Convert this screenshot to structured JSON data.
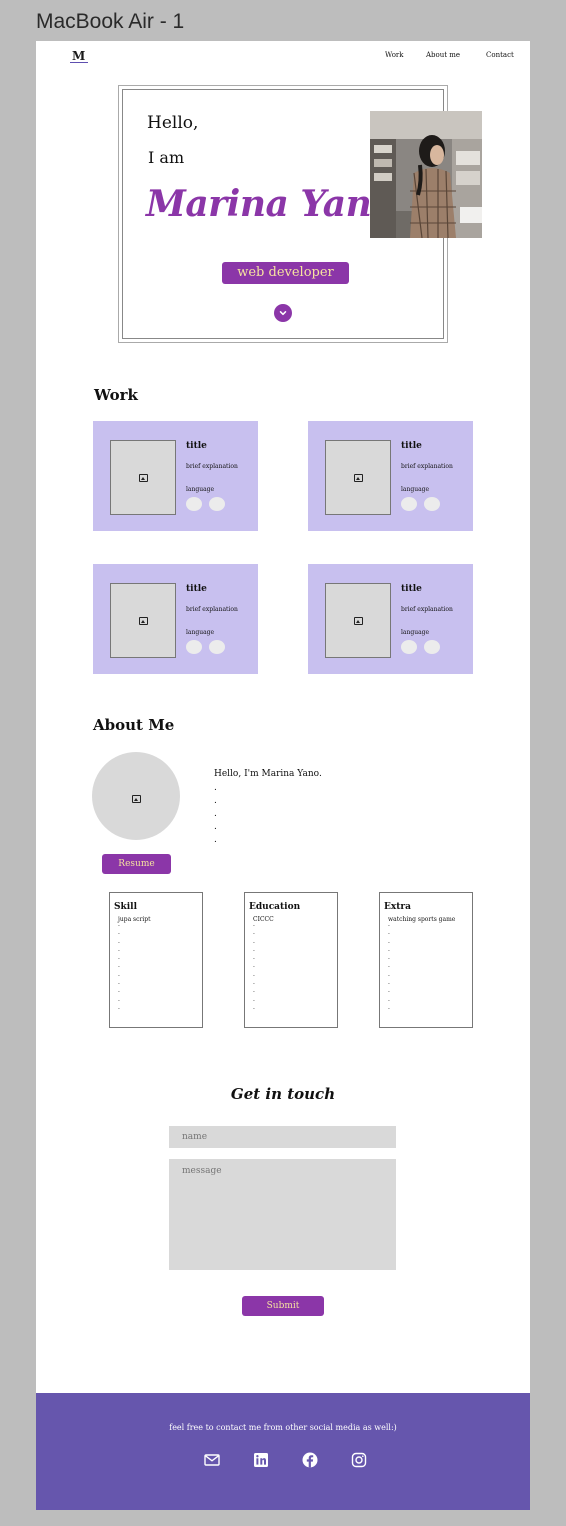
{
  "frame": {
    "title": "MacBook Air - 1"
  },
  "nav": {
    "logo": "M",
    "items": [
      {
        "label": "Work"
      },
      {
        "label": "About me"
      },
      {
        "label": "Contact"
      }
    ]
  },
  "hero": {
    "greeting": "Hello,",
    "intro": "I am",
    "name": "Marina Yano",
    "role_button": "web developer",
    "scroll_icon": "chevron-down-icon"
  },
  "work": {
    "heading": "Work",
    "cards": [
      {
        "title": "title",
        "explanation": "brief explanation",
        "language": "language"
      },
      {
        "title": "title",
        "explanation": "brief explanation",
        "language": "language"
      },
      {
        "title": "title",
        "explanation": "brief explanation",
        "language": "language"
      },
      {
        "title": "title",
        "explanation": "brief explanation",
        "language": "language"
      }
    ]
  },
  "about": {
    "heading": "About Me",
    "intro": "Hello, I'm Marina Yano.",
    "dots": ".\n.\n.\n.\n.",
    "resume_button": "Resume",
    "boxes": [
      {
        "title": "Skill",
        "first_item": "jupa script",
        "dots": ".\n.\n.\n.\n.\n.\n.\n.\n.\n.\n."
      },
      {
        "title": "Education",
        "first_item": "CICCC",
        "dots": ".\n.\n.\n.\n.\n.\n.\n.\n.\n.\n."
      },
      {
        "title": "Extra",
        "first_item": "watching sports game",
        "dots": ".\n.\n.\n.\n.\n.\n.\n.\n.\n.\n."
      }
    ]
  },
  "contact": {
    "heading": "Get in touch",
    "name_placeholder": "name",
    "message_placeholder": "message",
    "submit_button": "Submit"
  },
  "footer": {
    "text": "feel free to contact me from other social media as well:)",
    "icons": [
      "mail-icon",
      "linkedin-icon",
      "facebook-icon",
      "instagram-icon"
    ]
  },
  "colors": {
    "canvas_bg": "#bdbdbd",
    "accent_purple": "#8b36a8",
    "button_text": "#f6e3a0",
    "card_lavender": "#c8c0ef",
    "footer_purple": "#6656ad",
    "placeholder_gray": "#d9d9d9"
  }
}
